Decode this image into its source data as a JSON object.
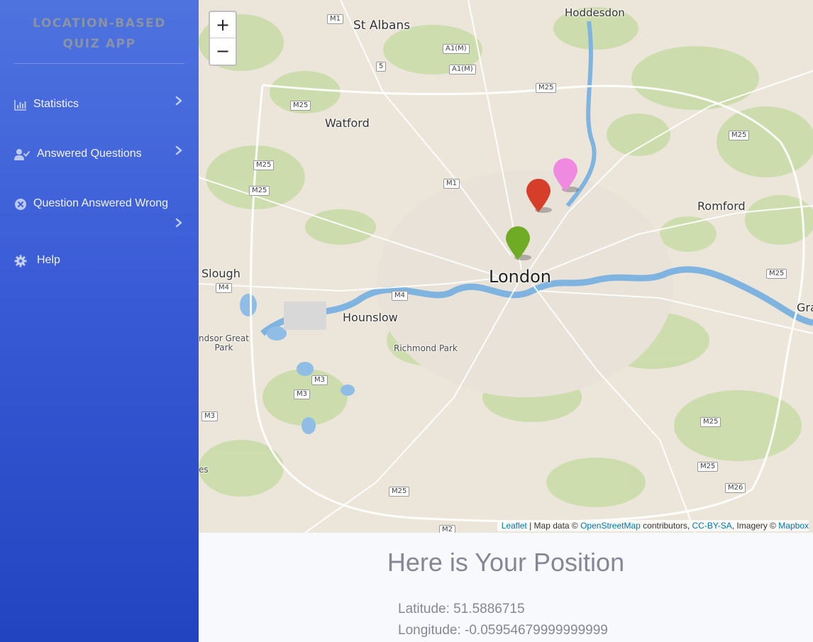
{
  "sidebar": {
    "brand_line1": "LOCATION-BASED",
    "brand_line2": "QUIZ APP",
    "items": [
      {
        "label": "Statistics",
        "icon": "chart-bar-icon"
      },
      {
        "label": "Answered Questions",
        "icon": "user-check-icon"
      },
      {
        "label": "Question Answered Wrong",
        "icon": "times-circle-icon"
      },
      {
        "label": "Help",
        "icon": "cog-icon"
      }
    ]
  },
  "map": {
    "zoom_in_label": "+",
    "zoom_out_label": "−",
    "places": {
      "hoddesdon": "Hoddesdon",
      "st_albans": "St Albans",
      "watford": "Watford",
      "romford": "Romford",
      "slough": "Slough",
      "london": "London",
      "hounslow": "Hounslow",
      "richmond_park": "Richmond Park",
      "windsor": "ndsor Great\nPark",
      "grays": "Gra",
      "edge_s": "es"
    },
    "roads": {
      "m1_top": "M1",
      "a1m_1": "A1(M)",
      "a1m_2": "A1(M)",
      "five": "5",
      "m25_1": "M25",
      "m25_2": "M25",
      "m25_3": "M25",
      "m25_4": "M25",
      "m25_5": "M25",
      "m1_mid": "M1",
      "m4_left": "M4",
      "m4_mid": "M4",
      "m25_6": "M25",
      "m3_1": "M3",
      "m3_2": "M3",
      "m3_3": "M3",
      "m25_7": "M25",
      "m25_8": "M25",
      "m25_9": "M25",
      "m26": "M26",
      "m2": "M2"
    },
    "markers": [
      {
        "name": "pink-marker",
        "color": "#f08ae0"
      },
      {
        "name": "red-marker",
        "color": "#d63e2a"
      },
      {
        "name": "green-marker",
        "color": "#6fab25"
      }
    ],
    "attribution": {
      "leaflet": "Leaflet",
      "sep1": " | Map data © ",
      "osm": "OpenStreetMap",
      "contrib": " contributors, ",
      "ccbysa": "CC-BY-SA",
      "imagery": ", Imagery © ",
      "mapbox": "Mapbox"
    }
  },
  "info": {
    "title": "Here is Your Position",
    "latitude_label": "Latitude: ",
    "latitude_value": "51.5886715",
    "longitude_label": "Longitude: ",
    "longitude_value": "-0.05954679999999999"
  }
}
